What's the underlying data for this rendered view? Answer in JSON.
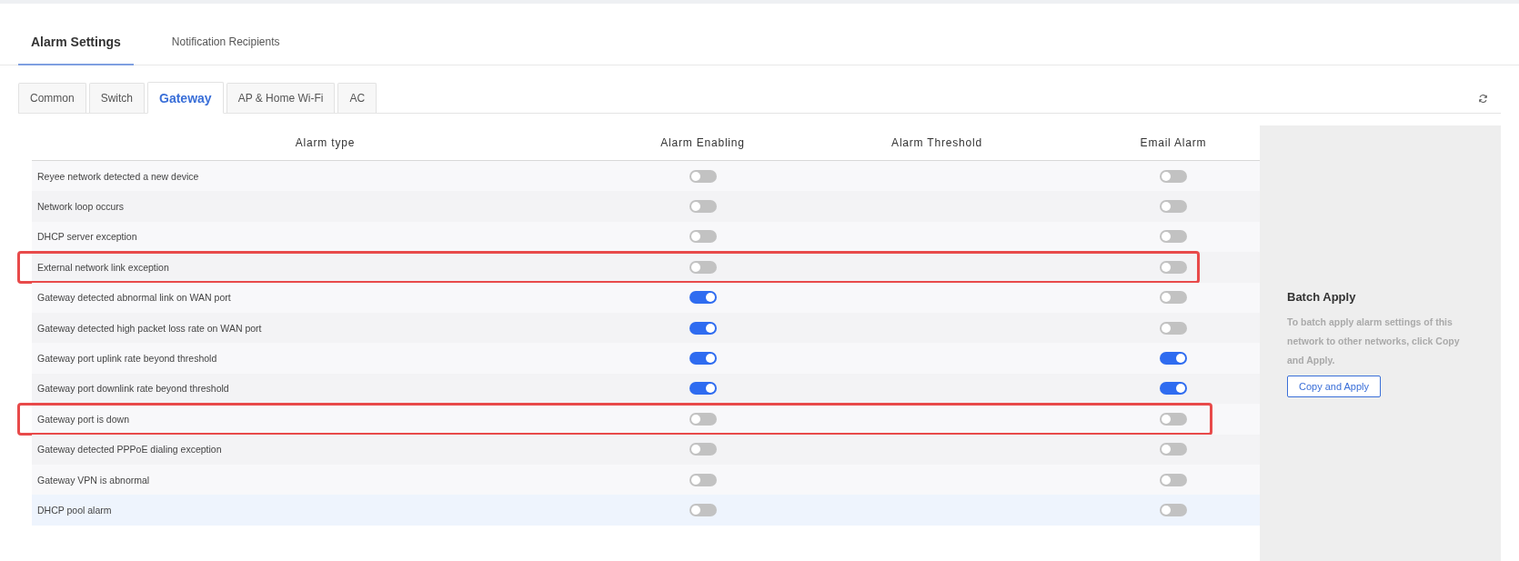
{
  "main_tabs": [
    {
      "label": "Alarm Settings",
      "selected": true
    },
    {
      "label": "Notification Recipients",
      "selected": false
    }
  ],
  "device_tabs": [
    {
      "label": "Common",
      "selected": false
    },
    {
      "label": "Switch",
      "selected": false
    },
    {
      "label": "Gateway",
      "selected": true
    },
    {
      "label": "AP & Home Wi-Fi",
      "selected": false
    },
    {
      "label": "AC",
      "selected": false
    }
  ],
  "table": {
    "columns": [
      "Alarm type",
      "Alarm Enabling",
      "Alarm Threshold",
      "Email Alarm"
    ],
    "rows": [
      {
        "alarm_type": "Reyee network detected a new device",
        "enabled": false,
        "email": false,
        "highlighted": false,
        "hovered": false
      },
      {
        "alarm_type": "Network loop occurs",
        "enabled": false,
        "email": false,
        "highlighted": false,
        "hovered": false
      },
      {
        "alarm_type": "DHCP server exception",
        "enabled": false,
        "email": false,
        "highlighted": false,
        "hovered": false
      },
      {
        "alarm_type": "External network link exception",
        "enabled": false,
        "email": false,
        "highlighted": true,
        "hovered": false
      },
      {
        "alarm_type": "Gateway detected abnormal link on WAN port",
        "enabled": true,
        "email": false,
        "highlighted": false,
        "hovered": false
      },
      {
        "alarm_type": "Gateway detected high packet loss rate on WAN port",
        "enabled": true,
        "email": false,
        "highlighted": false,
        "hovered": false
      },
      {
        "alarm_type": "Gateway port uplink rate beyond threshold",
        "enabled": true,
        "email": true,
        "highlighted": false,
        "hovered": false
      },
      {
        "alarm_type": "Gateway port downlink rate beyond threshold",
        "enabled": true,
        "email": true,
        "highlighted": false,
        "hovered": false
      },
      {
        "alarm_type": "Gateway port is down",
        "enabled": false,
        "email": false,
        "highlighted": true,
        "hovered": false
      },
      {
        "alarm_type": "Gateway detected PPPoE dialing exception",
        "enabled": false,
        "email": false,
        "highlighted": false,
        "hovered": false
      },
      {
        "alarm_type": "Gateway VPN is abnormal",
        "enabled": false,
        "email": false,
        "highlighted": false,
        "hovered": false
      },
      {
        "alarm_type": "DHCP pool alarm",
        "enabled": false,
        "email": false,
        "highlighted": false,
        "hovered": true
      }
    ]
  },
  "batch_apply": {
    "title": "Batch Apply",
    "description": "To batch apply alarm settings of this network to other networks, click Copy and Apply.",
    "button": "Copy and Apply"
  }
}
